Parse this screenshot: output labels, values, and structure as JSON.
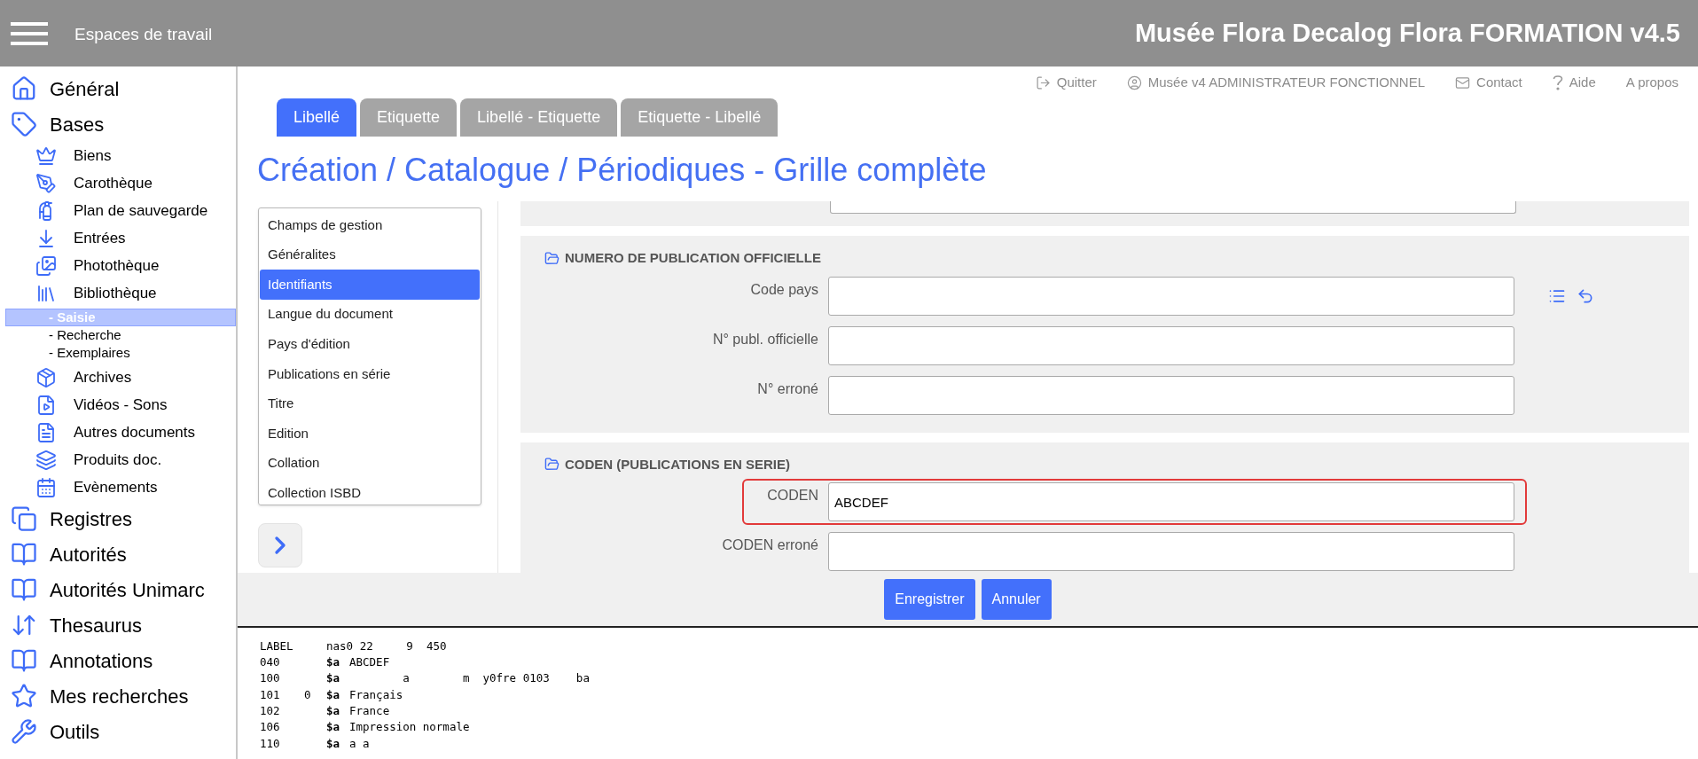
{
  "header": {
    "workspaces": "Espaces de travail",
    "title": "Musée Flora Decalog Flora FORMATION v4.5"
  },
  "sidebar": {
    "items": [
      {
        "label": "Général"
      },
      {
        "label": "Bases",
        "children": [
          {
            "label": "Biens"
          },
          {
            "label": "Carothèque"
          },
          {
            "label": "Plan de sauvegarde"
          },
          {
            "label": "Entrées"
          },
          {
            "label": "Photothèque"
          },
          {
            "label": "Bibliothèque",
            "children": [
              {
                "label": "- Saisie",
                "selected": true
              },
              {
                "label": "- Recherche",
                "selected": false
              },
              {
                "label": "- Exemplaires",
                "selected": false
              }
            ]
          },
          {
            "label": "Archives"
          },
          {
            "label": "Vidéos - Sons"
          },
          {
            "label": "Autres documents"
          },
          {
            "label": "Produits doc."
          },
          {
            "label": "Evènements"
          }
        ]
      },
      {
        "label": "Registres"
      },
      {
        "label": "Autorités"
      },
      {
        "label": "Autorités Unimarc"
      },
      {
        "label": "Thesaurus"
      },
      {
        "label": "Annotations"
      },
      {
        "label": "Mes recherches"
      },
      {
        "label": "Outils"
      }
    ]
  },
  "top_links": [
    {
      "label": "Quitter"
    },
    {
      "label": "Musée v4 ADMINISTRATEUR FONCTIONNEL"
    },
    {
      "label": "Contact"
    },
    {
      "label": "Aide"
    },
    {
      "label": "A propos"
    }
  ],
  "tabs": [
    {
      "label": "Libellé",
      "selected": true
    },
    {
      "label": "Etiquette",
      "selected": false
    },
    {
      "label": "Libellé - Etiquette",
      "selected": false
    },
    {
      "label": "Etiquette - Libellé",
      "selected": false
    }
  ],
  "page_title": "Création / Catalogue / Périodiques - Grille complète",
  "section_list": [
    {
      "label": "Champs de gestion",
      "selected": false
    },
    {
      "label": "Généralites",
      "selected": false
    },
    {
      "label": "Identifiants",
      "selected": true
    },
    {
      "label": "Langue du document",
      "selected": false
    },
    {
      "label": "Pays d'édition",
      "selected": false
    },
    {
      "label": "Publications en série",
      "selected": false
    },
    {
      "label": "Titre",
      "selected": false
    },
    {
      "label": "Edition",
      "selected": false
    },
    {
      "label": "Collation",
      "selected": false
    },
    {
      "label": "Collection ISBD",
      "selected": false
    }
  ],
  "form_sections": [
    {
      "kind": "cut"
    },
    {
      "kind": "group",
      "title": "NUMERO DE PUBLICATION OFFICIELLE",
      "fields": [
        {
          "label": "Code pays",
          "highlighted": false,
          "tools": true
        },
        {
          "label": "N° publ. officielle",
          "highlighted": false,
          "tools": false
        },
        {
          "label": "N° erroné",
          "highlighted": false,
          "tools": false
        }
      ]
    },
    {
      "kind": "group",
      "title": "CODEN (PUBLICATIONS EN SERIE)",
      "fields": [
        {
          "label": "CODEN",
          "value": "ABCDEF",
          "highlighted": true,
          "tools": false
        },
        {
          "label": "CODEN erroné",
          "highlighted": false,
          "tools": false
        }
      ]
    }
  ],
  "buttons": [
    {
      "label": "Enregistrer"
    },
    {
      "label": "Annuler"
    }
  ],
  "record": [
    {
      "tag": "LABEL",
      "text": "nas0 22     9  450"
    },
    {
      "tag": "040",
      "code": "$a",
      "text": "ABCDEF"
    },
    {
      "tag": "100",
      "code": "$a",
      "text": "        a        m  y0fre 0103    ba"
    },
    {
      "tag": "101",
      "ind": "0",
      "code": "$a",
      "text": "Français"
    },
    {
      "tag": "102",
      "code": "$a",
      "text": "France"
    },
    {
      "tag": "106",
      "code": "$a",
      "text": "Impression normale"
    },
    {
      "tag": "110",
      "code": "$a",
      "text": "a a"
    }
  ]
}
